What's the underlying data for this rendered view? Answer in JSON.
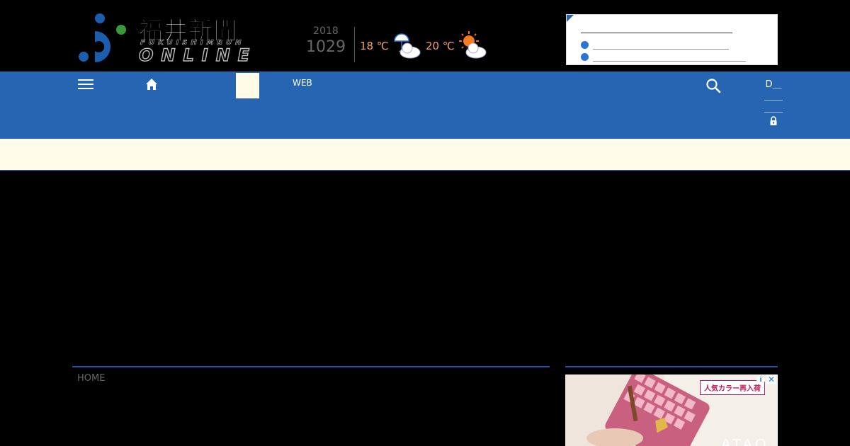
{
  "header": {
    "logo": {
      "title": "福井新聞",
      "subtitle": "FUKUISHIMBUN",
      "online": "ONLINE",
      "colors": {
        "blue": "#1b5eb0",
        "green": "#3a9a3a"
      }
    },
    "date": {
      "year": "2018",
      "month_day": "1029"
    },
    "weather": [
      {
        "temp": "18 ℃",
        "icon": "rain-cloud-icon"
      },
      {
        "temp": "20 ℃",
        "icon": "sun-cloud-icon"
      }
    ],
    "notices": [
      {
        "text": "＿＿＿＿＿＿＿＿＿＿＿＿＿＿＿＿"
      },
      {
        "text": "＿＿＿＿＿＿＿＿＿＿＿＿＿＿＿＿＿＿"
      }
    ]
  },
  "nav": {
    "menu_icon": "menu-icon",
    "home_icon": "home-icon",
    "web_label": "WEB",
    "search_icon": "search-icon",
    "login_lines": [
      "D＿",
      "＿＿",
      "＿＿"
    ],
    "lock_icon": "lock-icon",
    "color": "#2565b1"
  },
  "main": {
    "breadcrumb": "HOME"
  },
  "ad": {
    "badge": "人気カラー再入荷",
    "info": "i",
    "close": "✕",
    "brand": "ATAO"
  }
}
